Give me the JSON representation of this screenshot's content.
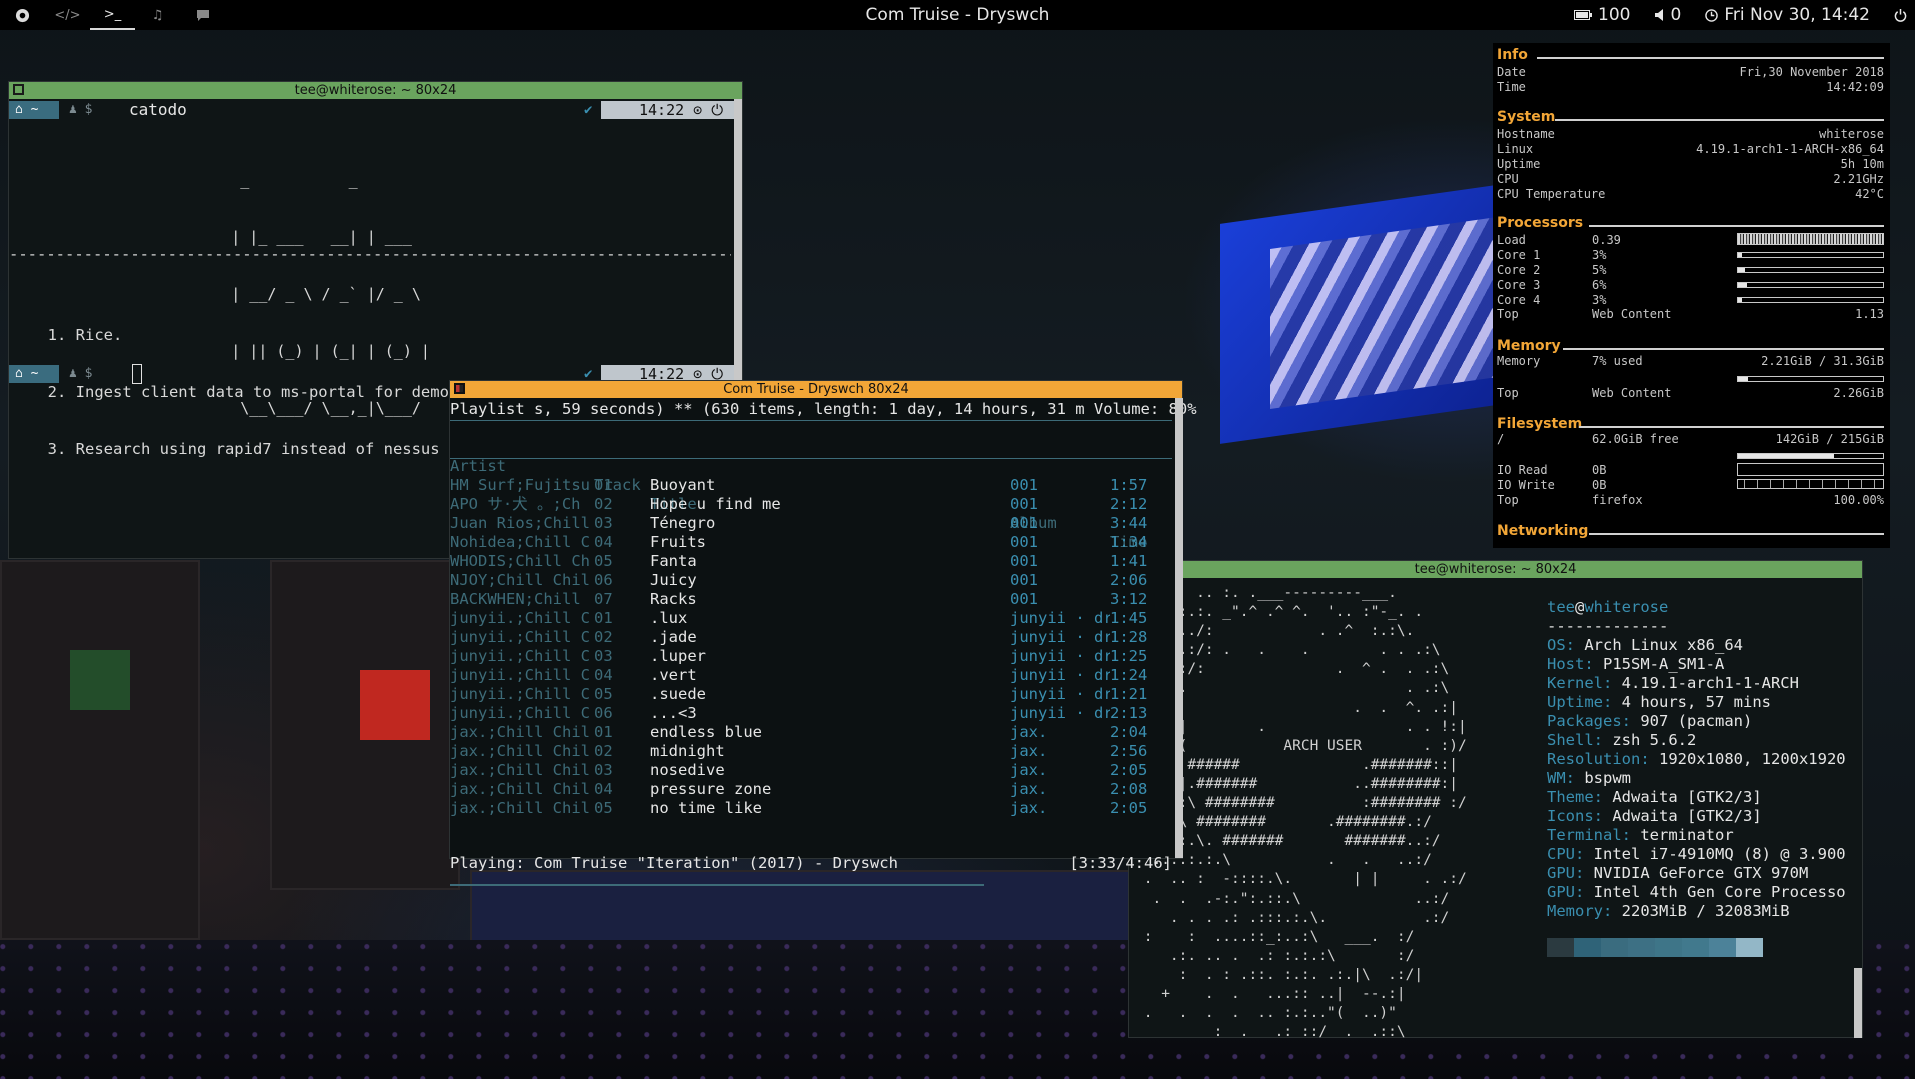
{
  "topbar": {
    "title": "Com Truise - Dryswch",
    "battery": "100",
    "volume": "0",
    "clock": "Fri Nov 30, 14:42",
    "icons": [
      "app-logo-icon",
      "code-icon",
      "terminal-icon",
      "music-icon",
      "chat-icon"
    ]
  },
  "todo": {
    "title": "tee@whiterose: ~ 80x24",
    "command": "catodo",
    "time": "14:22",
    "ascii_logo": [
      "         _           _",
      "        | |_ ___   __| | ___",
      "        | __/ _ \\ / _` |/ _ \\",
      "        | || (_) | (_| | (_) |",
      "         \\__\\___/ \\__,_|\\___/"
    ],
    "rule": "--------------------------------------------------------------------------------",
    "items": [
      "  1. Rice.",
      "  2. Ingest client data to ms-portal for demo on friday",
      "  3. Research using rapid7 instead of nessus for managed scanning"
    ]
  },
  "ncmpcpp": {
    "title": "Com Truise - Dryswch 80x24",
    "status": "Playlist s, 59 seconds) ** (630 items, length: 1 day, 14 hours, 31 m Volume: 80%",
    "headers": {
      "artist": "Artist",
      "track": "Track",
      "title": "Title",
      "album": "Album",
      "time": "Time"
    },
    "rows": [
      {
        "artist": "HM Surf;Fujitsu",
        "track": "01",
        "title": "Buoyant",
        "album": "001",
        "time": "1:57"
      },
      {
        "artist": "APO サ·犬 。;Ch",
        "track": "02",
        "title": "Hope u find me",
        "album": "001",
        "time": "2:12"
      },
      {
        "artist": "Juan Rios;Chill",
        "track": "03",
        "title": "Ténegro",
        "album": "001",
        "time": "3:44"
      },
      {
        "artist": "Nohidea;Chill C",
        "track": "04",
        "title": "Fruits",
        "album": "001",
        "time": "1:34"
      },
      {
        "artist": "WHODIS;Chill Ch",
        "track": "05",
        "title": "Fanta",
        "album": "001",
        "time": "1:41"
      },
      {
        "artist": "NJOY;Chill Chil",
        "track": "06",
        "title": "Juicy",
        "album": "001",
        "time": "2:06"
      },
      {
        "artist": "BACKWHEN;Chill",
        "track": "07",
        "title": "Racks",
        "album": "001",
        "time": "3:12"
      },
      {
        "artist": "junyii.;Chill C",
        "track": "01",
        "title": ".lux",
        "album": "junyii · dr",
        "time": "1:45"
      },
      {
        "artist": "junyii.;Chill C",
        "track": "02",
        "title": ".jade",
        "album": "junyii · dr",
        "time": "1:28"
      },
      {
        "artist": "junyii.;Chill C",
        "track": "03",
        "title": ".luper",
        "album": "junyii · dr",
        "time": "1:25"
      },
      {
        "artist": "junyii.;Chill C",
        "track": "04",
        "title": ".vert",
        "album": "junyii · dr",
        "time": "1:24"
      },
      {
        "artist": "junyii.;Chill C",
        "track": "05",
        "title": ".suede",
        "album": "junyii · dr",
        "time": "1:21"
      },
      {
        "artist": "junyii.;Chill C",
        "track": "06",
        "title": "...<3",
        "album": "junyii · dr",
        "time": "2:13"
      },
      {
        "artist": "jax.;Chill Chil",
        "track": "01",
        "title": "endless blue",
        "album": "jax.",
        "time": "2:04"
      },
      {
        "artist": "jax.;Chill Chil",
        "track": "02",
        "title": "midnight",
        "album": "jax.",
        "time": "2:56"
      },
      {
        "artist": "jax.;Chill Chil",
        "track": "03",
        "title": "nosedive",
        "album": "jax.",
        "time": "2:05"
      },
      {
        "artist": "jax.;Chill Chil",
        "track": "04",
        "title": "pressure zone",
        "album": "jax.",
        "time": "2:08"
      },
      {
        "artist": "jax.;Chill Chil",
        "track": "05",
        "title": "no time like",
        "album": "jax.",
        "time": "2:05"
      }
    ],
    "playing": "Playing: Com Truise \"Iteration\" (2017) - Dryswch",
    "progress": "[3:33/4:46]",
    "progress_fraction": 0.74
  },
  "conky": {
    "info": {
      "heading": "Info",
      "date_label": "Date",
      "date": "Fri,30 November 2018",
      "time_label": "Time",
      "time": "14:42:09"
    },
    "system": {
      "heading": "System",
      "rows": [
        {
          "k": "Hostname",
          "v": "whiterose"
        },
        {
          "k": "Linux",
          "v": "4.19.1-arch1-1-ARCH-x86_64"
        },
        {
          "k": "Uptime",
          "v": "5h 10m"
        },
        {
          "k": "CPU",
          "v": "2.21GHz"
        },
        {
          "k": "CPU Temperature",
          "v": "42°C"
        }
      ]
    },
    "processors": {
      "heading": "Processors",
      "rows": [
        {
          "k": "Load",
          "m": "0.39",
          "fill": 0.39
        },
        {
          "k": "Core 1",
          "m": "3%",
          "fill": 0.03
        },
        {
          "k": "Core 2",
          "m": "5%",
          "fill": 0.05
        },
        {
          "k": "Core 3",
          "m": "6%",
          "fill": 0.06
        },
        {
          "k": "Core 4",
          "m": "3%",
          "fill": 0.03
        }
      ],
      "top_label": "Top",
      "top_proc": "Web Content",
      "top_val": "1.13"
    },
    "memory": {
      "heading": "Memory",
      "k": "Memory",
      "m": "7% used",
      "v": "2.21GiB / 31.3GiB",
      "fill": 0.07,
      "top_label": "Top",
      "top_proc": "Web Content",
      "top_val": "2.26GiB"
    },
    "filesystem": {
      "heading": "Filesystem",
      "k": "/",
      "m": "62.0GiB free",
      "v": "142GiB / 215GiB",
      "fill": 0.66,
      "io_read_label": "IO Read",
      "io_read": "0B",
      "io_write_label": "IO Write",
      "io_write": "0B",
      "top_label": "Top",
      "top_proc": "firefox",
      "top_val": "100.00%"
    },
    "networking": {
      "heading": "Networking"
    }
  },
  "neofetch": {
    "title": "tee@whiterose: ~ 80x24",
    "user": "tee",
    "at": "@",
    "host": "whiterose",
    "dashes": "-------------",
    "rows": [
      {
        "k": "OS",
        "v": "Arch Linux x86_64"
      },
      {
        "k": "Host",
        "v": "P15SM-A_SM1-A"
      },
      {
        "k": "Kernel",
        "v": "4.19.1-arch1-1-ARCH"
      },
      {
        "k": "Uptime",
        "v": "4 hours, 57 mins"
      },
      {
        "k": "Packages",
        "v": "907 (pacman)"
      },
      {
        "k": "Shell",
        "v": "zsh 5.6.2"
      },
      {
        "k": "Resolution",
        "v": "1920x1080, 1200x1920"
      },
      {
        "k": "WM",
        "v": "bspwm"
      },
      {
        "k": "Theme",
        "v": "Adwaita [GTK2/3]"
      },
      {
        "k": "Icons",
        "v": "Adwaita [GTK2/3]"
      },
      {
        "k": "Terminal",
        "v": "terminator"
      },
      {
        "k": "CPU",
        "v": "Intel i7-4910MQ (8) @ 3.900"
      },
      {
        "k": "GPU",
        "v": "NVIDIA GeForce GTX 970M"
      },
      {
        "k": "GPU",
        "v": "Intel 4th Gen Core Processo"
      },
      {
        "k": "Memory",
        "v": "2203MiB / 32083MiB"
      }
    ],
    "ascii": [
      " .     .. :. .___---------___.",
      "  .  :.:. _\".^ .^ ^.  '.. :\"-_. .",
      "   .:../:            . .^  :.:\\.",
      " +. :.:/: .   .    .        . . .:\\",
      " _ :::/:               .  ^ .  . .:\\",
      ":::./.                         . .:\\",
      ":..|:                    .  .  ^. .:|",
      ": ..||        .                . . !:|",
      ". ::\\(           ARCH USER       . :)/",
      ".:.|. ######              .#######::|",
      ":  ::|.#######           ..########:|",
      ". .. :\\ ########          :######## :/",
      ": -.:\\ ########       .########.:/",
      " . .::.\\. #######       #######..:/",
      "  :::.:.:.\\           .   .   ..:/",
      " .  .. :  -::::.\\.       | |     . .:/",
      "  .  .  .-:.\":.::.\\             ..:/",
      "    . . . .: .:::.:.\\.           .:/",
      " :    :  ....::_:..:\\   ___.  :/",
      "    .:. .. .  .: :.:.:\\       :/",
      "     :  . : .::. :.:. .:.|\\  .:/|",
      "   +    .  .   ...:: ..|  --.:|",
      " .   .  .  .  .. :.:..\"(  ..)\"",
      "         :  .   .: ::/  .  .::\\"
    ],
    "colors": [
      "#2b3a40",
      "#2f6378",
      "#3a6c7f",
      "#3d7084",
      "#3e7588",
      "#41798d",
      "#4c8299",
      "#93b7c7"
    ]
  }
}
